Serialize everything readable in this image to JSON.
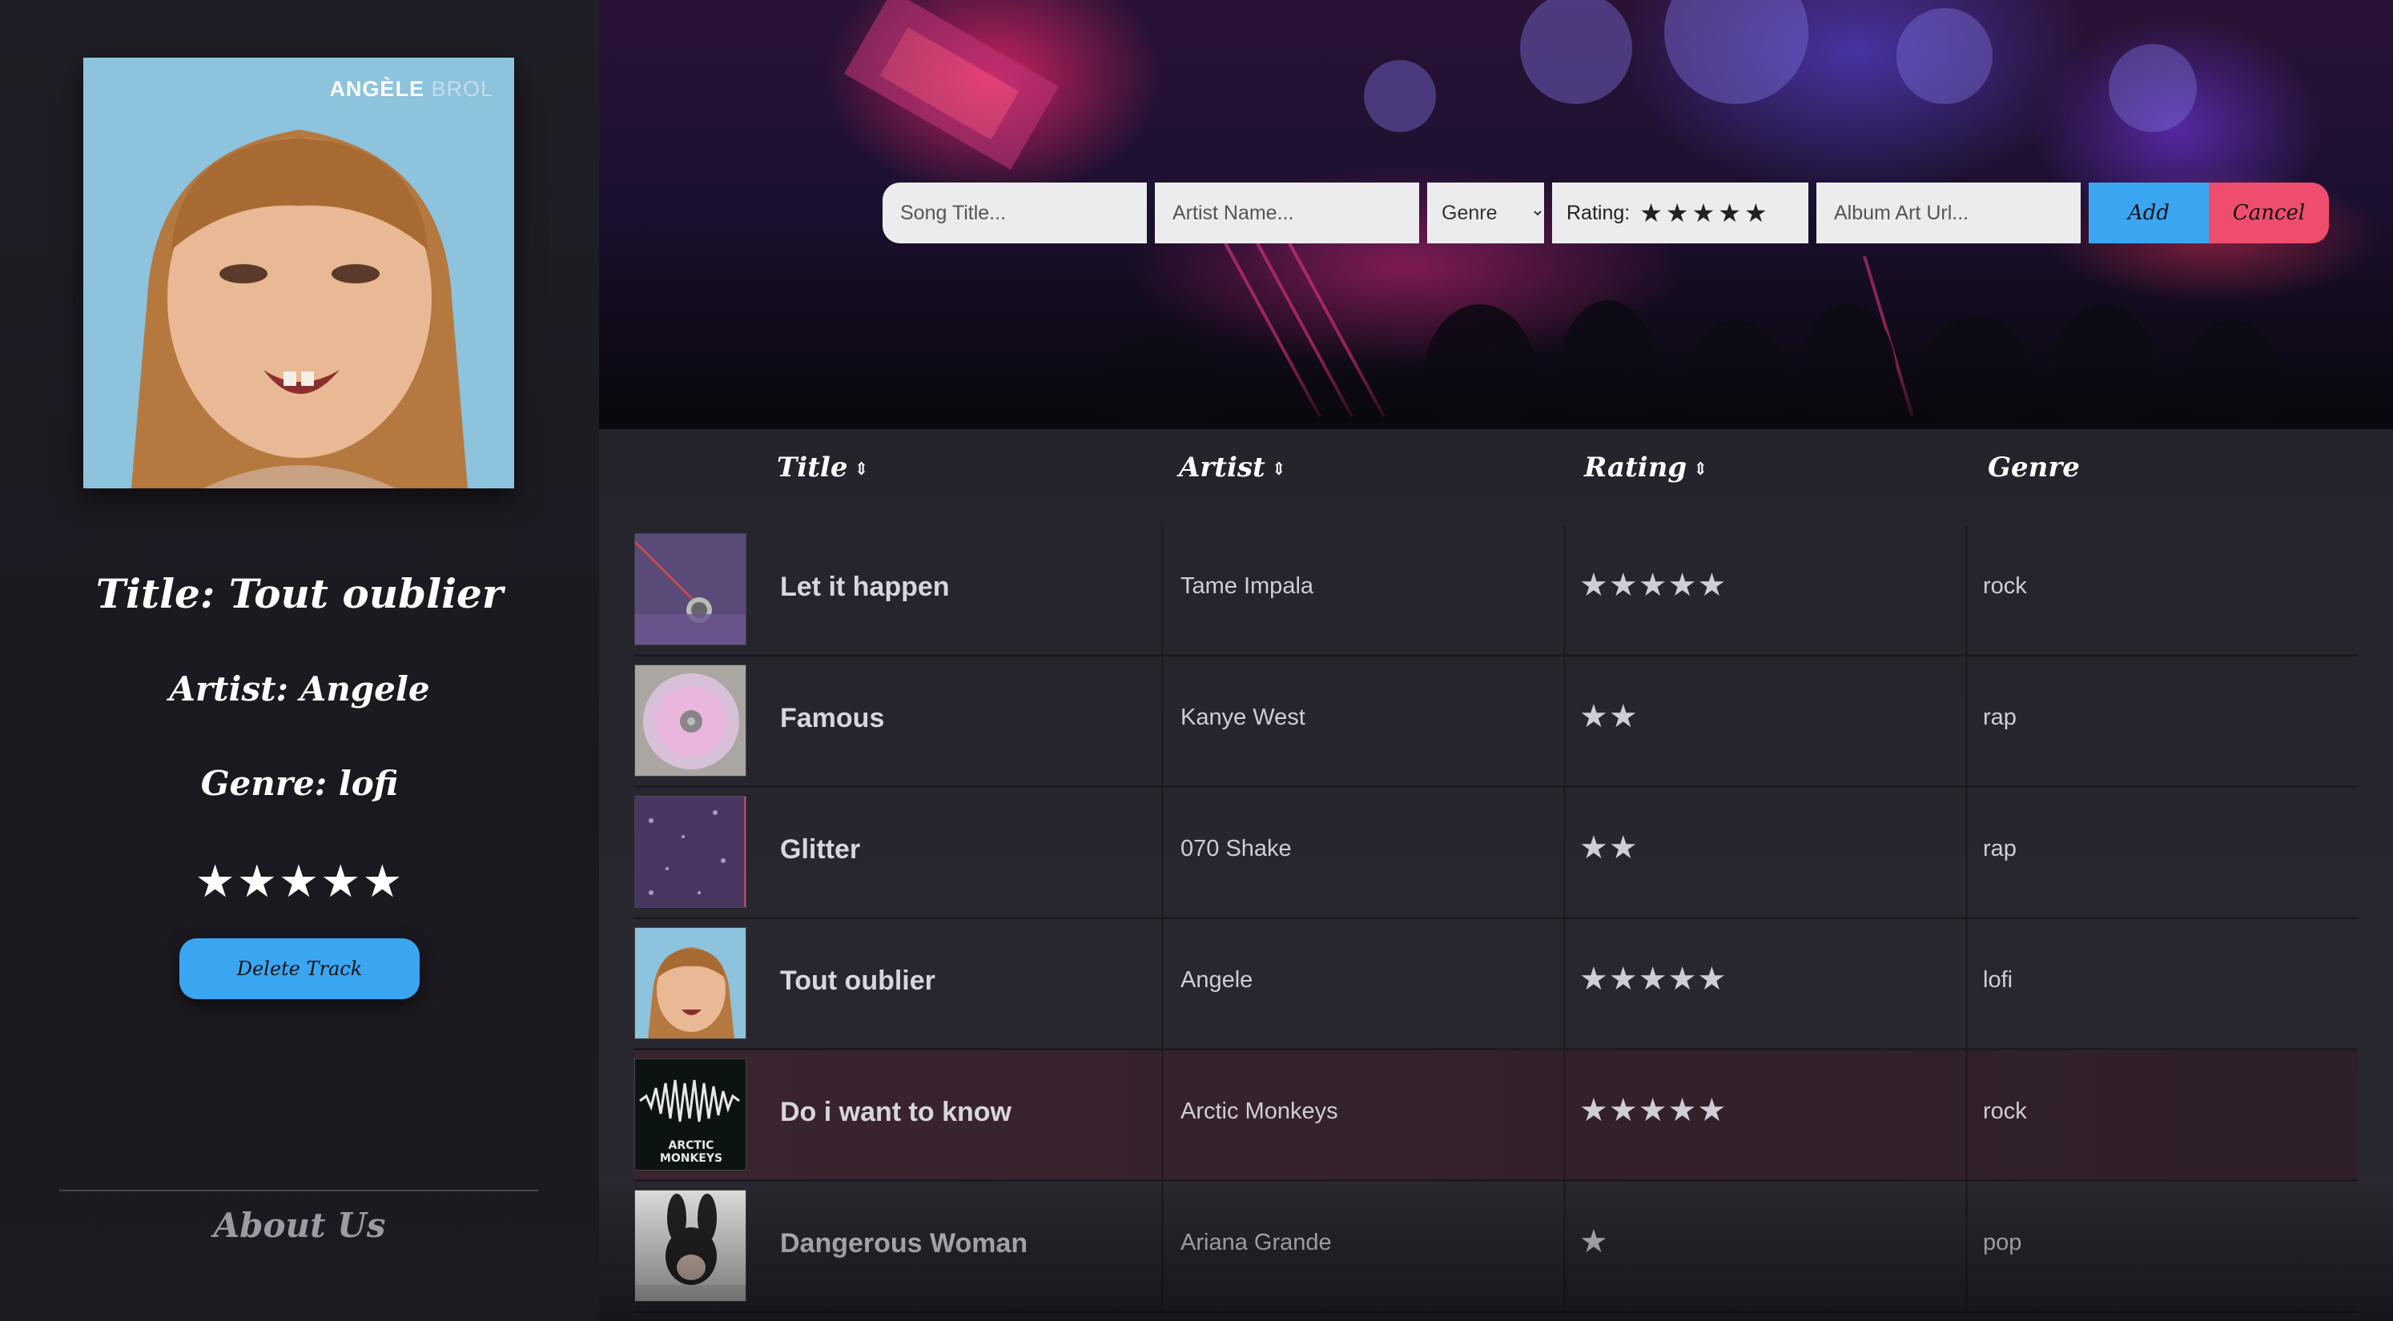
{
  "sidebar": {
    "cover": {
      "brand": "ANGÈLE",
      "brand_dim": "BROL"
    },
    "title": "Title: Tout oublier",
    "artist": "Artist: Angele",
    "genre": "Genre: lofi",
    "stars": "★★★★★",
    "delete_label": "Delete Track",
    "about_label": "About Us"
  },
  "form": {
    "song_placeholder": "Song Title...",
    "artist_placeholder": "Artist Name...",
    "genre_selected": "Genre",
    "rating_label": "Rating:",
    "rating_stars": "★★★★★",
    "album_placeholder": "Album Art Url...",
    "add_label": "Add",
    "cancel_label": "Cancel"
  },
  "table": {
    "headers": {
      "title": "Title",
      "artist": "Artist",
      "rating": "Rating",
      "genre": "Genre"
    },
    "sort_icon": "⇕",
    "rows": [
      {
        "title": "Let it happen",
        "artist": "Tame Impala",
        "rating": 5,
        "stars": "★★★★★",
        "genre": "rock",
        "thumb": "vinyl-ball",
        "highlight": false
      },
      {
        "title": "Famous",
        "artist": "Kanye West",
        "rating": 2,
        "stars": "★★",
        "genre": "rap",
        "thumb": "cd-disc",
        "highlight": false
      },
      {
        "title": "Glitter",
        "artist": "070 Shake",
        "rating": 2,
        "stars": "★★",
        "genre": "rap",
        "thumb": "glitter",
        "highlight": false
      },
      {
        "title": "Tout oublier",
        "artist": "Angele",
        "rating": 5,
        "stars": "★★★★★",
        "genre": "lofi",
        "thumb": "portrait",
        "highlight": false
      },
      {
        "title": "Do i want to know",
        "artist": "Arctic Monkeys",
        "rating": 5,
        "stars": "★★★★★",
        "genre": "rock",
        "thumb": "waveform",
        "thumb_text": "ARCTIC MONKEYS",
        "highlight": true
      },
      {
        "title": "Dangerous Woman",
        "artist": "Ariana Grande",
        "rating": 1,
        "stars": "★",
        "genre": "pop",
        "thumb": "bunny-mask",
        "highlight": false
      }
    ]
  }
}
